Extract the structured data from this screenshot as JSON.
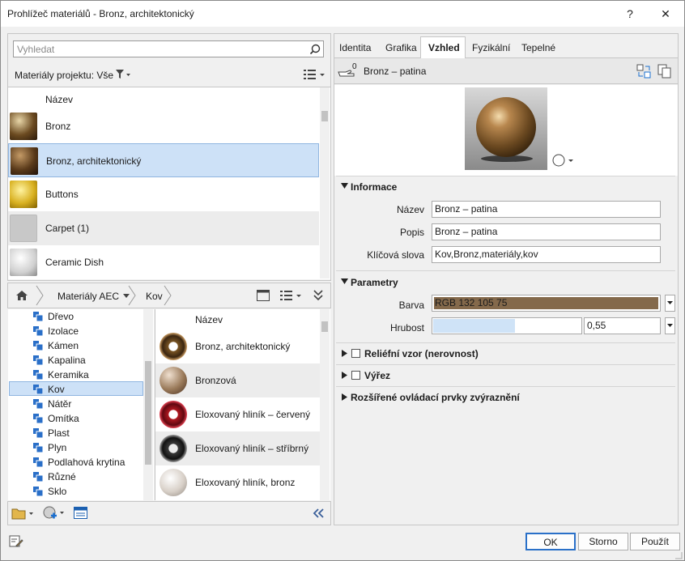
{
  "window": {
    "title": "Prohlížeč materiálů - Bronz, architektonický",
    "help": "?",
    "close": "✕"
  },
  "search": {
    "placeholder": "Vyhledat"
  },
  "project": {
    "label": "Materiály projektu: Vše",
    "header": "Název",
    "items": [
      {
        "label": "Bronz",
        "thumb": "#6b4a20"
      },
      {
        "label": "Bronz, architektonický",
        "thumb": "#5a3a1a"
      },
      {
        "label": "Buttons",
        "thumb": "#d8b020"
      },
      {
        "label": "Carpet (1)",
        "thumb": "#c8c8c8"
      },
      {
        "label": "Ceramic Dish",
        "thumb": "#e6e6e6"
      }
    ]
  },
  "library": {
    "breadcrumb": [
      "Materiály AEC",
      "Kov"
    ],
    "tree": [
      "Dřevo",
      "Izolace",
      "Kámen",
      "Kapalina",
      "Keramika",
      "Kov",
      "Nátěr",
      "Omítka",
      "Plast",
      "Plyn",
      "Podlahová krytina",
      "Různé",
      "Sklo"
    ],
    "header": "Název",
    "items": [
      {
        "label": "Bronz, architektonický",
        "thumb": "#7a5524"
      },
      {
        "label": "Bronzová",
        "thumb": "#9a7a5a"
      },
      {
        "label": "Eloxovaný hliník – červený",
        "thumb": "#b01820"
      },
      {
        "label": "Eloxovaný hliník – stříbrný",
        "thumb": "#3a3a3a"
      },
      {
        "label": "Eloxovaný hliník, bronz",
        "thumb": "#d8d0c8"
      }
    ]
  },
  "tabs": [
    "Identita",
    "Grafika",
    "Vzhled",
    "Fyzikální",
    "Tepelné"
  ],
  "asset": {
    "count": "0",
    "name": "Bronz – patina"
  },
  "info": {
    "title": "Informace",
    "name_label": "Název",
    "name": "Bronz – patina",
    "desc_label": "Popis",
    "desc": "Bronz – patina",
    "kw_label": "Klíčová slova",
    "kw": "Kov,Bronz,materiály,kov"
  },
  "params": {
    "title": "Parametry",
    "color_label": "Barva",
    "color_value": "RGB 132 105 75",
    "color": "#84694b",
    "rough_label": "Hrubost",
    "rough_value": "0,55",
    "rough_fraction": 0.55
  },
  "sections": {
    "relief": "Reliéfní vzor (nerovnost)",
    "cutout": "Výřez",
    "advanced": "Rozšířené ovládací prvky zvýraznění"
  },
  "buttons": {
    "ok": "OK",
    "cancel": "Storno",
    "apply": "Použít"
  }
}
